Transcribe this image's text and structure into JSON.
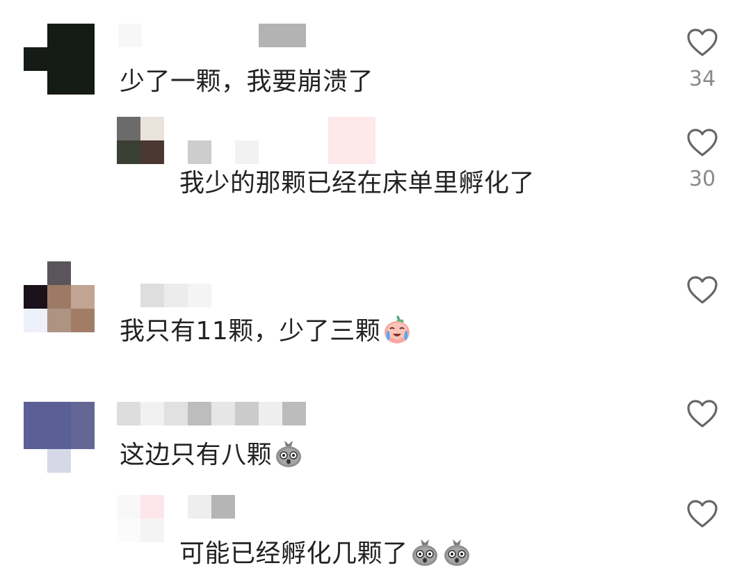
{
  "icons": {
    "like": "heart-outline-icon",
    "crying_face": "crying-peach-emoji",
    "shocked_face": "shocked-bag-emoji"
  },
  "colors": {
    "text": "#222222",
    "count": "#8a8a8a",
    "heart": "#666666"
  },
  "comments": [
    {
      "text": "少了一颗，我要崩溃了",
      "likes": "34",
      "is_reply": false
    },
    {
      "text": "我少的那颗已经在床单里孵化了",
      "likes": "30",
      "is_reply": true
    },
    {
      "text": "我只有11颗，少了三颗",
      "likes": "",
      "is_reply": false,
      "emojis": [
        "crying-peach-emoji"
      ]
    },
    {
      "text": "这边只有八颗",
      "likes": "",
      "is_reply": false,
      "emojis": [
        "shocked-bag-emoji"
      ]
    },
    {
      "text": "可能已经孵化几颗了",
      "likes": "",
      "is_reply": true,
      "emojis": [
        "shocked-bag-emoji",
        "shocked-bag-emoji"
      ]
    }
  ]
}
